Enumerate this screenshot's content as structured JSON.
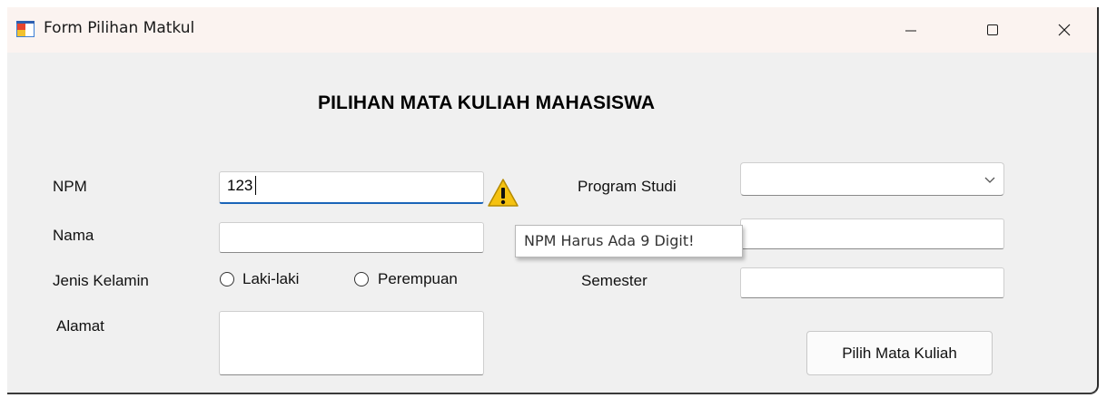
{
  "window": {
    "title": "Form Pilihan Matkul",
    "icon": "windows-form-icon",
    "controls": {
      "minimize": "—",
      "maximize": "☐",
      "close": "✕"
    }
  },
  "form": {
    "heading": "PILIHAN MATA KULIAH MAHASISWA",
    "npm": {
      "label": "NPM",
      "value": "123"
    },
    "nama": {
      "label": "Nama",
      "value": ""
    },
    "jenis_kelamin": {
      "label": "Jenis Kelamin",
      "options": [
        "Laki-laki",
        "Perempuan"
      ],
      "selected": null
    },
    "alamat": {
      "label": "Alamat",
      "value": ""
    },
    "program_studi": {
      "label": "Program Studi",
      "value": ""
    },
    "hidden_field": {
      "value": ""
    },
    "semester": {
      "label": "Semester",
      "value": ""
    },
    "submit_label": "Pilih Mata Kuliah"
  },
  "validation": {
    "icon": "warning-icon",
    "tooltip": "NPM Harus Ada 9 Digit!",
    "warning_color": "#f5c211"
  },
  "colors": {
    "focus_accent": "#1a64b8",
    "background": "#f0f0f0",
    "titlebar": "#fbf3f0"
  }
}
